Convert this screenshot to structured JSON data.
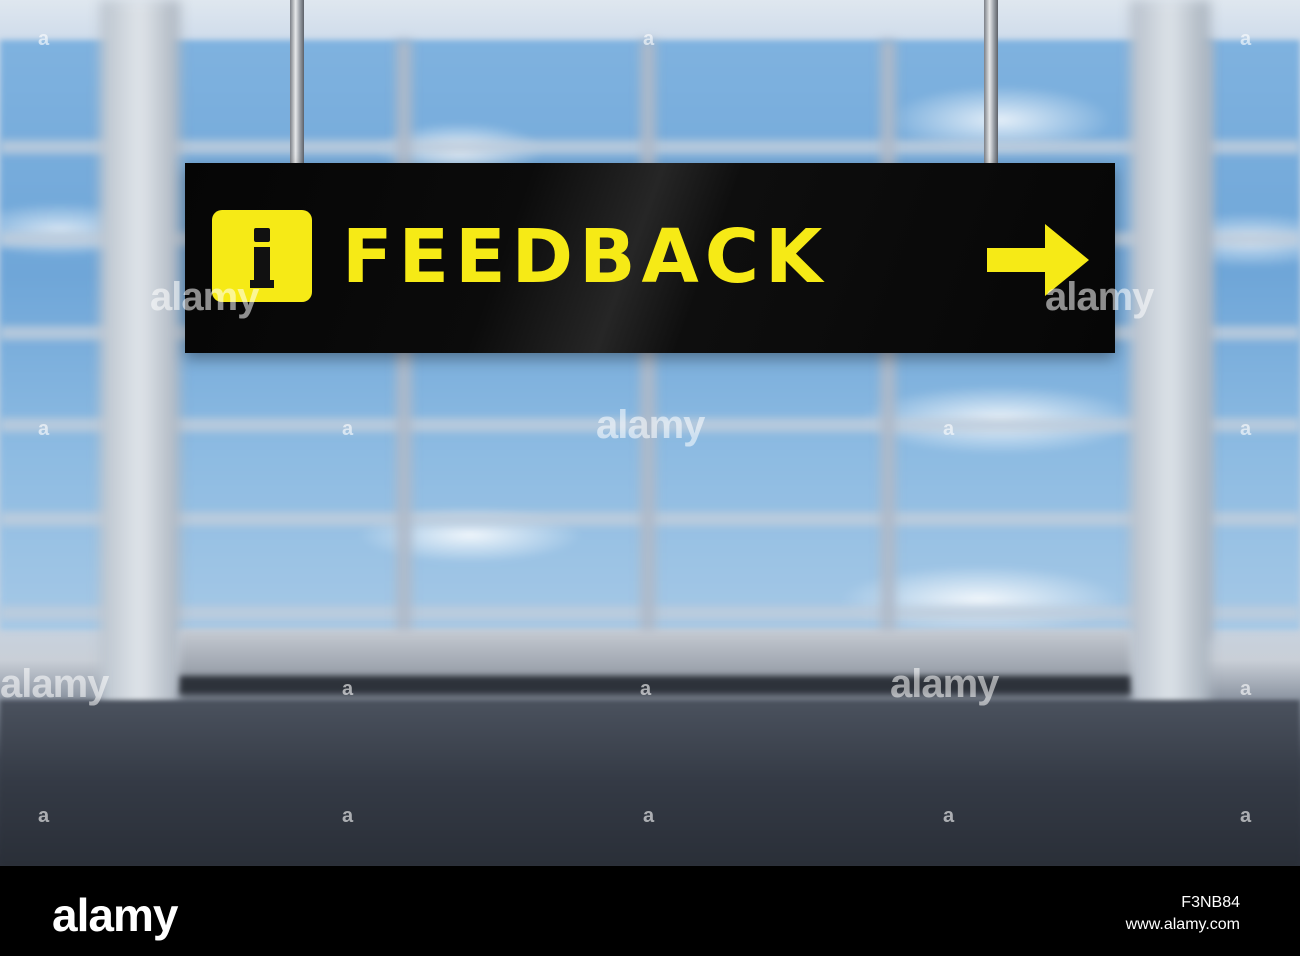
{
  "sign": {
    "text": "FEEDBACK",
    "info_letter": "i",
    "colors": {
      "background": "#0a0a0a",
      "accent": "#f6ea16"
    },
    "icons": [
      "info-icon",
      "arrow-right-icon"
    ]
  },
  "watermark": {
    "brand": "alamy",
    "short": "a",
    "stock_id": "F3NB84",
    "site": "www.alamy.com"
  }
}
